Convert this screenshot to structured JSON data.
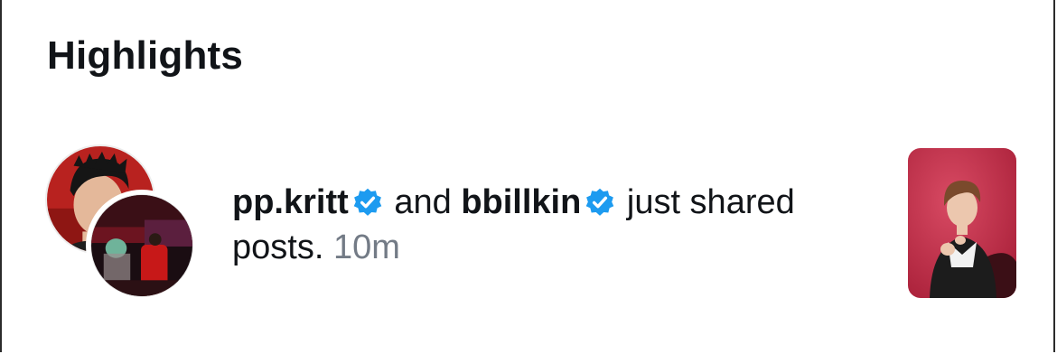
{
  "section": {
    "title": "Highlights"
  },
  "notification": {
    "user1": "pp.kritt",
    "conj": " and ",
    "user2": "bbillkin",
    "action": " just shared posts. ",
    "time": "10m",
    "verified_icon": "verified-badge-icon",
    "verified_color": "#1d9bf0"
  },
  "colors": {
    "text": "#111418",
    "muted": "#737b86",
    "avatar_bg_red": "#b8221f",
    "thumb_bg_pink": "#c7334f"
  }
}
